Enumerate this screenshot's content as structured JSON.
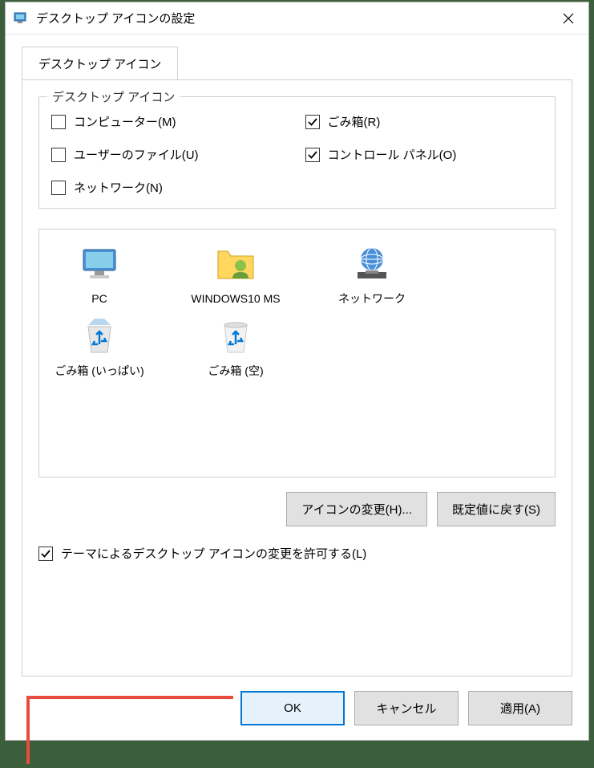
{
  "titlebar": {
    "title": "デスクトップ アイコンの設定"
  },
  "tab": {
    "label": "デスクトップ アイコン"
  },
  "fieldset": {
    "legend": "デスクトップ アイコン",
    "checkboxes": [
      {
        "label": "コンピューター(M)",
        "checked": false
      },
      {
        "label": "ごみ箱(R)",
        "checked": true
      },
      {
        "label": "ユーザーのファイル(U)",
        "checked": false
      },
      {
        "label": "コントロール パネル(O)",
        "checked": true
      },
      {
        "label": "ネットワーク(N)",
        "checked": false
      }
    ]
  },
  "preview": {
    "items": [
      {
        "label": "PC",
        "icon": "pc"
      },
      {
        "label": "WINDOWS10 MS",
        "icon": "user"
      },
      {
        "label": "ネットワーク",
        "icon": "network"
      },
      {
        "label": "ごみ箱 (いっぱい)",
        "icon": "recycle-full"
      },
      {
        "label": "ごみ箱 (空)",
        "icon": "recycle-empty"
      }
    ]
  },
  "buttons": {
    "change_icon": "アイコンの変更(H)...",
    "restore_default": "既定値に戻す(S)"
  },
  "theme_checkbox": {
    "label": "テーマによるデスクトップ アイコンの変更を許可する(L)",
    "checked": true
  },
  "dialog_buttons": {
    "ok": "OK",
    "cancel": "キャンセル",
    "apply": "適用(A)"
  }
}
